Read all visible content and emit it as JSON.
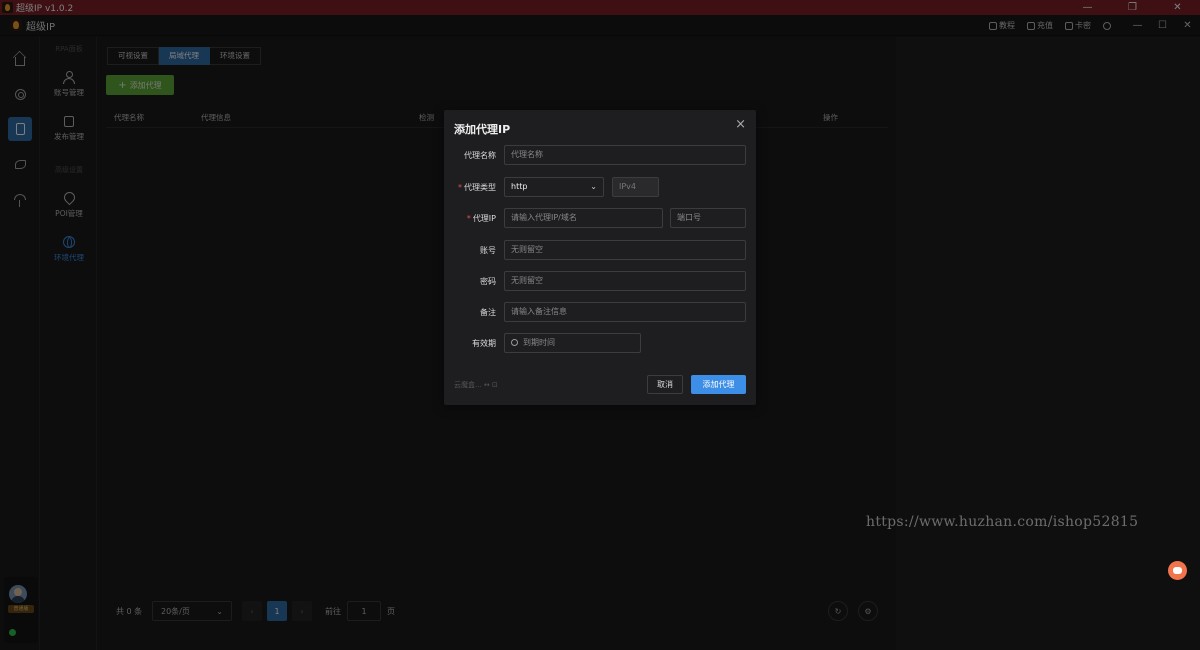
{
  "window": {
    "title": "超级IP v1.0.2",
    "controls": [
      "—",
      "❐",
      "✕"
    ]
  },
  "appbar": {
    "brand": "超级IP",
    "links": [
      {
        "icon": "help-icon",
        "label": "教程"
      },
      {
        "icon": "grid-icon",
        "label": "充值"
      },
      {
        "icon": "gift-icon",
        "label": "卡密"
      }
    ],
    "window_controls": [
      "—",
      "☐",
      "✕"
    ]
  },
  "iconrail": {
    "icons": [
      "home-icon",
      "target-icon",
      "phone-icon",
      "leaf-icon",
      "umbrella-icon"
    ],
    "active_index": 2
  },
  "menu": {
    "section1": "RPA面板",
    "section2": "高级设置",
    "items": [
      {
        "label": "账号管理",
        "icon": "user-icon"
      },
      {
        "label": "发布管理",
        "icon": "edit-icon"
      },
      {
        "label": "POI管理",
        "icon": "pin-icon"
      },
      {
        "label": "环境代理",
        "icon": "globe-icon",
        "active": true
      }
    ]
  },
  "user": {
    "vip_label": "普通版"
  },
  "tabs": [
    {
      "label": "可视设置"
    },
    {
      "label": "局域代理",
      "active": true
    },
    {
      "label": "环境设置"
    }
  ],
  "toolbar": {
    "add_label": "添加代理"
  },
  "table": {
    "columns": [
      "代理名称",
      "代理信息",
      "检测",
      "操作"
    ]
  },
  "pager": {
    "total": "共 0 条",
    "page_size": "20条/页",
    "prev": "‹",
    "current_page": "1",
    "next": "›",
    "goto_prefix": "前往",
    "goto_value": "1",
    "goto_suffix": "页"
  },
  "watermark": "https://www.huzhan.com/ishop52815",
  "modal": {
    "title": "添加代理IP",
    "close": "×",
    "fields": {
      "name": {
        "label": "代理名称",
        "placeholder": "代理名称"
      },
      "type": {
        "label": "代理类型",
        "value": "http",
        "version": "IPv4"
      },
      "ip": {
        "label": "代理IP",
        "placeholder": "请输入代理IP/域名",
        "port_placeholder": "端口号"
      },
      "account": {
        "label": "账号",
        "placeholder": "无则留空"
      },
      "password": {
        "label": "密码",
        "placeholder": "无则留空"
      },
      "remark": {
        "label": "备注",
        "placeholder": "请输入备注信息"
      },
      "expiry": {
        "label": "有效期",
        "placeholder": "到期时间"
      }
    },
    "footer_note": "云魔盒... ↔ ⊡",
    "cancel": "取消",
    "submit": "添加代理"
  },
  "colors": {
    "accent": "#2f6ea8",
    "primary_btn": "#3d8ee6",
    "add_btn": "#5fa838",
    "titlebar": "#7d1e26",
    "chat": "#f1744d"
  }
}
